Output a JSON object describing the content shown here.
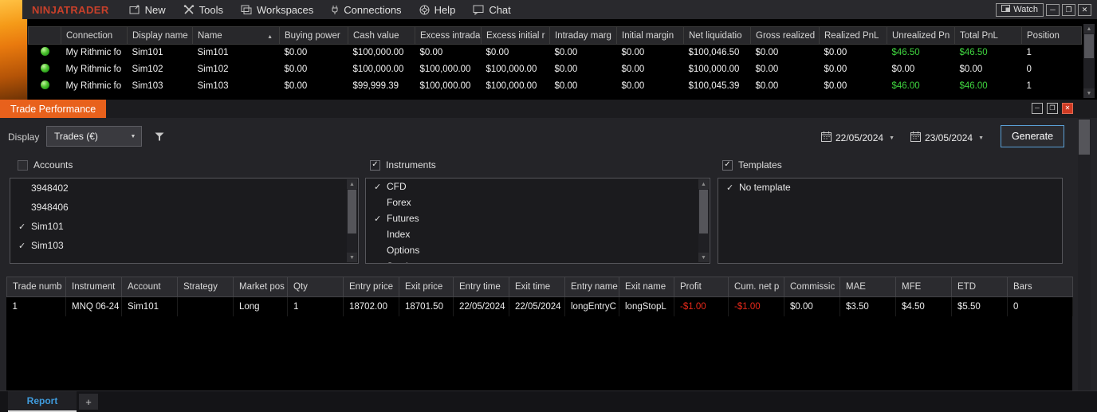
{
  "window": {
    "logo": "NINJATRADER",
    "watch_label": "Watch"
  },
  "menu": {
    "items": [
      "New",
      "Tools",
      "Workspaces",
      "Connections",
      "Help",
      "Chat"
    ]
  },
  "accounts": {
    "headers": [
      "Connection",
      "Display name",
      "Name",
      "Buying power",
      "Cash value",
      "Excess intrada",
      "Excess initial r",
      "Intraday marg",
      "Initial margin",
      "Net liquidatio",
      "Gross realized",
      "Realized PnL",
      "Unrealized Pn",
      "Total PnL",
      "Position"
    ],
    "sort_column": "Name",
    "rows": [
      {
        "status": "connected",
        "cells": [
          "My Rithmic fo",
          "Sim101",
          "Sim101",
          "$0.00",
          "$100,000.00",
          "$0.00",
          "$0.00",
          "$0.00",
          "$0.00",
          "$100,046.50",
          "$0.00",
          "$0.00",
          "$46.50",
          "$46.50",
          "1"
        ]
      },
      {
        "status": "connected",
        "cells": [
          "My Rithmic fo",
          "Sim102",
          "Sim102",
          "$0.00",
          "$100,000.00",
          "$100,000.00",
          "$100,000.00",
          "$0.00",
          "$0.00",
          "$100,000.00",
          "$0.00",
          "$0.00",
          "$0.00",
          "$0.00",
          "0"
        ]
      },
      {
        "status": "connected",
        "cells": [
          "My Rithmic fo",
          "Sim103",
          "Sim103",
          "$0.00",
          "$99,999.39",
          "$100,000.00",
          "$100,000.00",
          "$0.00",
          "$0.00",
          "$100,045.39",
          "$0.00",
          "$0.00",
          "$46.00",
          "$46.00",
          "1"
        ]
      }
    ]
  },
  "tp": {
    "title": "Trade Performance",
    "display_label": "Display",
    "display_value": "Trades (€)",
    "date_from": "22/05/2024",
    "date_to": "23/05/2024",
    "generate_label": "Generate",
    "sections": {
      "accounts": {
        "label": "Accounts",
        "checked": false
      },
      "instruments": {
        "label": "Instruments",
        "checked": true
      },
      "templates": {
        "label": "Templates",
        "checked": true
      }
    },
    "accounts_items": [
      {
        "label": "3948402",
        "checked": false
      },
      {
        "label": "3948406",
        "checked": false
      },
      {
        "label": "Sim101",
        "checked": true
      },
      {
        "label": "Sim103",
        "checked": true
      }
    ],
    "instruments_items": [
      {
        "label": "CFD",
        "checked": true
      },
      {
        "label": "Forex",
        "checked": false
      },
      {
        "label": "Futures",
        "checked": true
      },
      {
        "label": "Index",
        "checked": false
      },
      {
        "label": "Options",
        "checked": false
      },
      {
        "label": "Stock",
        "checked": false
      }
    ],
    "templates_items": [
      {
        "label": "No template",
        "checked": true
      }
    ],
    "trades": {
      "headers": [
        "Trade numb",
        "Instrument",
        "Account",
        "Strategy",
        "Market pos",
        "Qty",
        "Entry price",
        "Exit price",
        "Entry time",
        "Exit time",
        "Entry name",
        "Exit name",
        "Profit",
        "Cum. net p",
        "Commissic",
        "MAE",
        "MFE",
        "ETD",
        "Bars"
      ],
      "rows": [
        {
          "cells": [
            "1",
            "MNQ 06-24",
            "Sim101",
            "",
            "Long",
            "1",
            "18702.00",
            "18701.50",
            "22/05/2024",
            "22/05/2024",
            "longEntryC",
            "longStopL",
            "-$1.00",
            "-$1.00",
            "$0.00",
            "$3.50",
            "$4.50",
            "$5.50",
            "0"
          ]
        }
      ]
    },
    "tabs": {
      "report": "Report",
      "add": "+"
    }
  }
}
